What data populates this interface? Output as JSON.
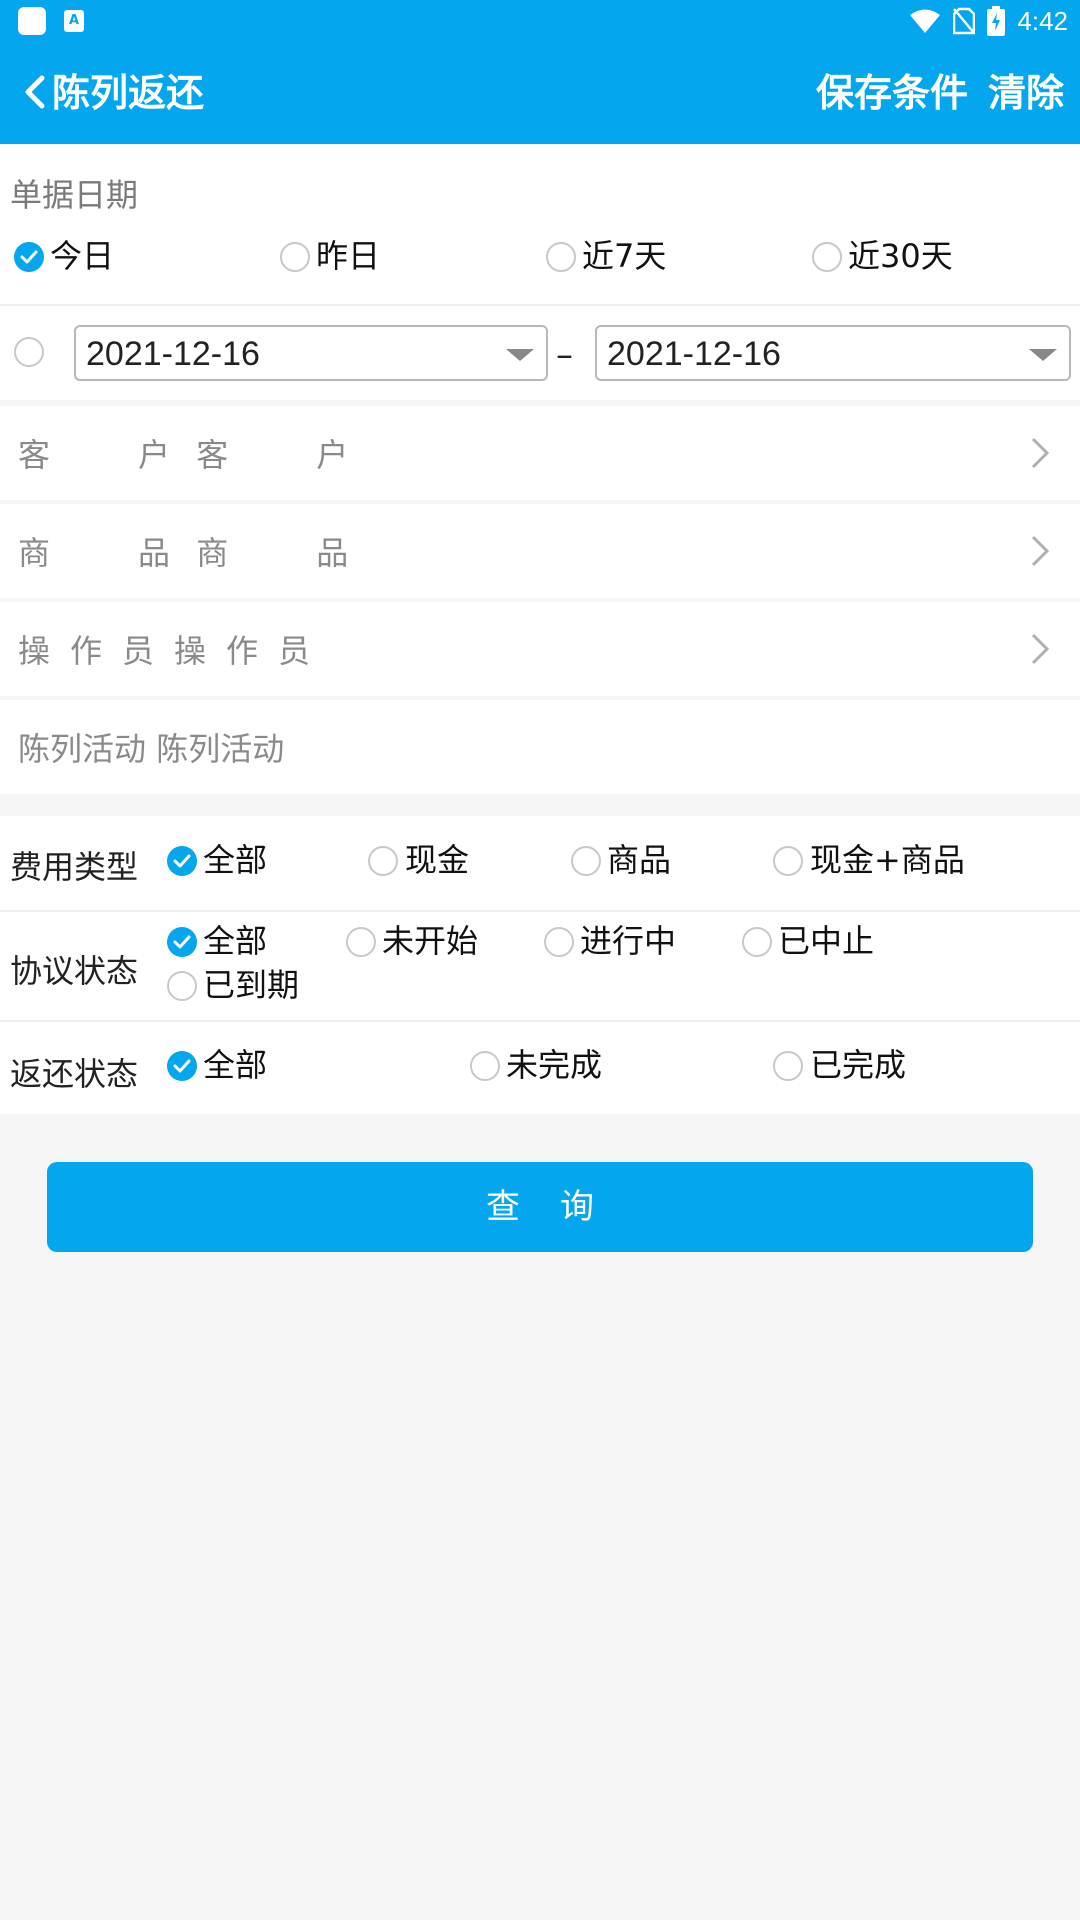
{
  "status_bar": {
    "time": "4:42"
  },
  "header": {
    "title": "陈列返还",
    "save_label": "保存条件",
    "clear_label": "清除"
  },
  "date_section": {
    "label": "单据日期",
    "options": [
      {
        "label": "今日",
        "checked": true
      },
      {
        "label": "昨日",
        "checked": false
      },
      {
        "label": "近7天",
        "checked": false
      },
      {
        "label": "近30天",
        "checked": false
      }
    ],
    "custom_range": {
      "checked": false,
      "start": "2021-12-16",
      "end": "2021-12-16",
      "separator": "–"
    }
  },
  "pickers": [
    {
      "label": "客　　户",
      "value": "客　　户"
    },
    {
      "label": "商　　品",
      "value": "商　　品"
    },
    {
      "label": "操作员",
      "value": "操作员"
    }
  ],
  "activity": {
    "label": "陈列活动",
    "placeholder": "陈列活动"
  },
  "filters": {
    "fee_type": {
      "label": "费用类型",
      "options": [
        {
          "label": "全部",
          "checked": true
        },
        {
          "label": "现金",
          "checked": false
        },
        {
          "label": "商品",
          "checked": false
        },
        {
          "label": "现金+商品",
          "checked": false
        }
      ]
    },
    "agreement_status": {
      "label": "协议状态",
      "options": [
        {
          "label": "全部",
          "checked": true
        },
        {
          "label": "未开始",
          "checked": false
        },
        {
          "label": "进行中",
          "checked": false
        },
        {
          "label": "已中止",
          "checked": false
        },
        {
          "label": "已到期",
          "checked": false
        }
      ]
    },
    "return_status": {
      "label": "返还状态",
      "options": [
        {
          "label": "全部",
          "checked": true
        },
        {
          "label": "未完成",
          "checked": false
        },
        {
          "label": "已完成",
          "checked": false
        }
      ]
    }
  },
  "query_button": "查询",
  "colors": {
    "accent": "#04a6ed",
    "background": "#f5f5f5"
  }
}
